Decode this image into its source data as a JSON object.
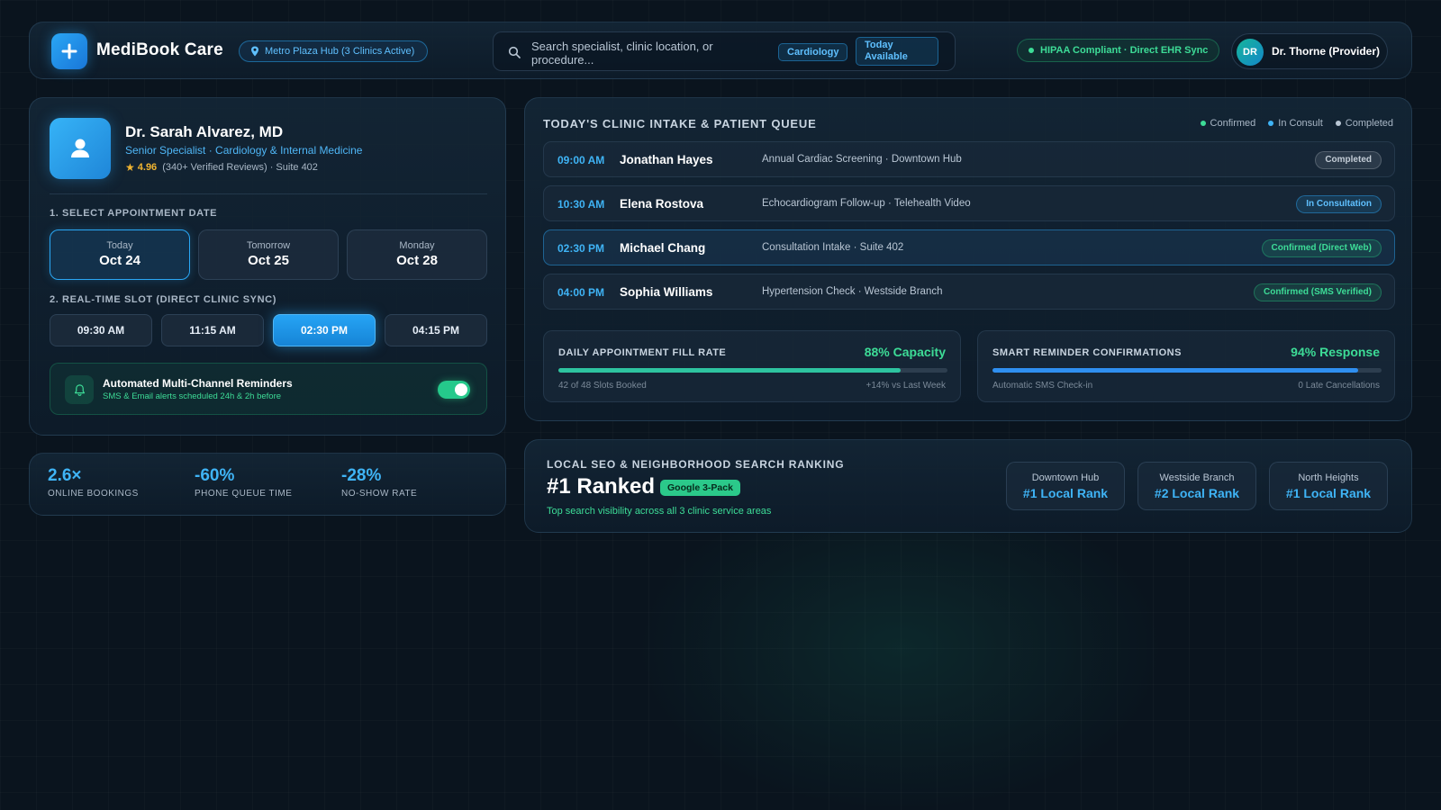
{
  "header": {
    "brand": "MediBook Care",
    "location_pill": "Metro Plaza Hub (3 Clinics Active)",
    "search_placeholder": "Search specialist, clinic location, or procedure...",
    "chip_specialty": "Cardiology",
    "chip_availability": "Today Available",
    "compliance": "HIPAA Compliant · Direct EHR Sync",
    "user_initials": "DR",
    "user_name": "Dr. Thorne (Provider)",
    "icons": [
      "plus-icon",
      "map-pin-icon",
      "search-icon"
    ]
  },
  "doctor": {
    "name": "Dr. Sarah Alvarez, MD",
    "title": "Senior Specialist · Cardiology & Internal Medicine",
    "rating": "4.96",
    "rating_detail": "(340+ Verified Reviews) · Suite 402",
    "date_section_label": "1. SELECT APPOINTMENT DATE",
    "dates": [
      {
        "label": "Today",
        "date": "Oct 24",
        "selected": true
      },
      {
        "label": "Tomorrow",
        "date": "Oct 25",
        "selected": false
      },
      {
        "label": "Monday",
        "date": "Oct 28",
        "selected": false
      }
    ],
    "slot_section_label": "2. REAL-TIME SLOT (DIRECT CLINIC SYNC)",
    "slots": [
      {
        "time": "09:30 AM",
        "selected": false
      },
      {
        "time": "11:15 AM",
        "selected": false
      },
      {
        "time": "02:30 PM",
        "selected": true
      },
      {
        "time": "04:15 PM",
        "selected": false
      }
    ],
    "reminder": {
      "title": "Automated Multi-Channel Reminders",
      "subtitle": "SMS & Email alerts scheduled 24h & 2h before",
      "enabled": true
    }
  },
  "stats": [
    {
      "value": "2.6×",
      "label": "ONLINE BOOKINGS"
    },
    {
      "value": "-60%",
      "label": "PHONE QUEUE TIME"
    },
    {
      "value": "-28%",
      "label": "NO-SHOW RATE"
    }
  ],
  "queue": {
    "title": "TODAY'S CLINIC INTAKE & PATIENT QUEUE",
    "legend": [
      {
        "label": "Confirmed",
        "color": "#3ddc97"
      },
      {
        "label": "In Consult",
        "color": "#3fb4f6"
      },
      {
        "label": "Completed",
        "color": "#b9c6d4"
      }
    ],
    "rows": [
      {
        "time": "09:00 AM",
        "name": "Jonathan Hayes",
        "desc": "Annual Cardiac Screening · Downtown Hub",
        "status": "Completed",
        "status_type": "gray"
      },
      {
        "time": "10:30 AM",
        "name": "Elena Rostova",
        "desc": "Echocardiogram Follow-up · Telehealth Video",
        "status": "In Consultation",
        "status_type": "blue"
      },
      {
        "time": "02:30 PM",
        "name": "Michael Chang",
        "desc": "Consultation Intake · Suite 402",
        "status": "Confirmed (Direct Web)",
        "status_type": "green"
      },
      {
        "time": "04:00 PM",
        "name": "Sophia Williams",
        "desc": "Hypertension Check · Westside Branch",
        "status": "Confirmed (SMS Verified)",
        "status_type": "green"
      }
    ],
    "metrics": [
      {
        "label": "DAILY APPOINTMENT FILL RATE",
        "value": "88% Capacity",
        "fill_percent": 88,
        "foot_left": "42 of 48 Slots Booked",
        "foot_right": "+14% vs Last Week",
        "color": "#2ec4a0"
      },
      {
        "label": "SMART REMINDER CONFIRMATIONS",
        "value": "94% Response",
        "fill_percent": 94,
        "foot_left": "Automatic SMS Check-in",
        "foot_right": "0 Late Cancellations",
        "color": "#2f8ff0"
      }
    ]
  },
  "seo": {
    "label": "LOCAL SEO & NEIGHBORHOOD SEARCH RANKING",
    "headline": "#1 Ranked",
    "badge": "Google 3-Pack",
    "subtitle": "Top search visibility across all 3 clinic service areas",
    "ranks": [
      {
        "location": "Downtown Hub",
        "rank": "#1 Local Rank"
      },
      {
        "location": "Westside Branch",
        "rank": "#2 Local Rank"
      },
      {
        "location": "North Heights",
        "rank": "#1 Local Rank"
      }
    ]
  },
  "colors": {
    "accent_blue": "#2aa7f5",
    "accent_green": "#3ddc97",
    "star": "#f2b531",
    "background": "#0a141e"
  }
}
